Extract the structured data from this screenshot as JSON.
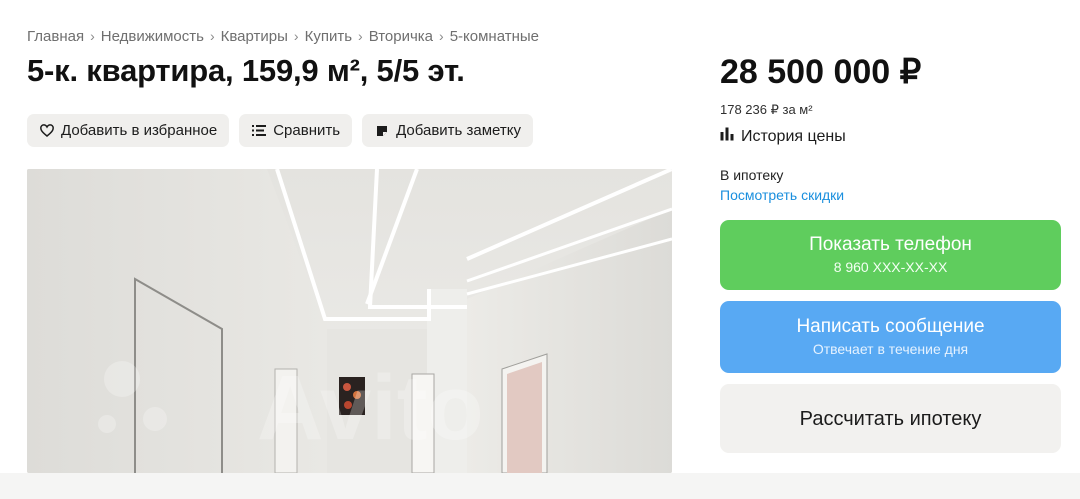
{
  "breadcrumb": [
    "Главная",
    "Недвижимость",
    "Квартиры",
    "Купить",
    "Вторичка",
    "5-комнатные"
  ],
  "breadcrumb_separator": "›",
  "title": "5-к. квартира, 159,9 м², 5/5 эт.",
  "actions": {
    "favorite": "Добавить в избранное",
    "compare": "Сравнить",
    "note": "Добавить заметку"
  },
  "photo": {
    "watermark": "Avito"
  },
  "price": {
    "total": "28 500 000 ₽",
    "per_m2": "178 236 ₽ за м²",
    "history_label": "История цены"
  },
  "mortgage": {
    "label": "В ипотеку",
    "discounts_link": "Посмотреть скидки"
  },
  "buttons": {
    "phone_label": "Показать телефон",
    "phone_number": "8 960 XXX-XX-XX",
    "message_label": "Написать сообщение",
    "message_sub": "Отвечает в течение дня",
    "mortgage_calc": "Рассчитать ипотеку"
  },
  "colors": {
    "phone_button": "#5fcd5d",
    "message_button": "#58a9f3",
    "link": "#1a8fde",
    "pill_bg": "#f0efed"
  },
  "icons": [
    "heart-icon",
    "compare-icon",
    "note-icon",
    "chart-icon"
  ]
}
